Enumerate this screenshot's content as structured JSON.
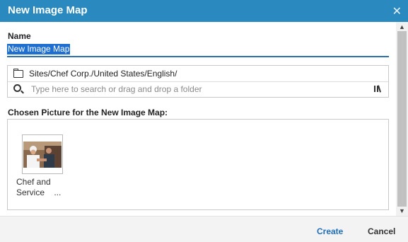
{
  "dialog": {
    "title": "New Image Map",
    "close_icon": "close-icon"
  },
  "name": {
    "label": "Name",
    "value": "New Image Map"
  },
  "folder": {
    "icon": "folder-icon",
    "path": "Sites/Chef Corp./United States/English/"
  },
  "search": {
    "icon": "search-icon",
    "placeholder": "Type here to search or drag and drop a folder",
    "browse_icon": "library-browse-icon"
  },
  "chosen": {
    "label": "Chosen Picture for the New Image Map:",
    "items": [
      {
        "caption_line1": "Chef and",
        "caption_line2": "Service    ..."
      }
    ]
  },
  "footer": {
    "create_label": "Create",
    "cancel_label": "Cancel"
  },
  "colors": {
    "titlebar": "#2a8ac0",
    "accent": "#1f6fb8"
  }
}
